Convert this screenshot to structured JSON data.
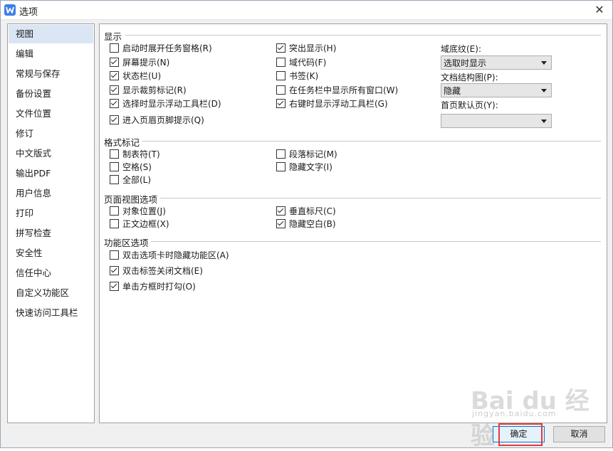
{
  "window": {
    "title": "选项"
  },
  "sidebar": {
    "items": [
      {
        "label": "视图",
        "active": true
      },
      {
        "label": "编辑"
      },
      {
        "label": "常规与保存"
      },
      {
        "label": "备份设置"
      },
      {
        "label": "文件位置"
      },
      {
        "label": "修订"
      },
      {
        "label": "中文版式"
      },
      {
        "label": "输出PDF"
      },
      {
        "label": "用户信息"
      },
      {
        "label": "打印"
      },
      {
        "label": "拼写检查"
      },
      {
        "label": "安全性"
      },
      {
        "label": "信任中心"
      },
      {
        "label": "自定义功能区"
      },
      {
        "label": "快速访问工具栏"
      }
    ]
  },
  "display": {
    "title": "显示",
    "options": [
      {
        "label": "启动时展开任务窗格(R)",
        "checked": false
      },
      {
        "label": "屏幕提示(N)",
        "checked": true
      },
      {
        "label": "状态栏(U)",
        "checked": true
      },
      {
        "label": "显示裁剪标记(R)",
        "checked": true
      },
      {
        "label": "选择时显示浮动工具栏(D)",
        "checked": true
      },
      {
        "label": "进入页眉页脚提示(Q)",
        "checked": true
      },
      {
        "label": "突出显示(H)",
        "checked": true
      },
      {
        "label": "域代码(F)",
        "checked": false
      },
      {
        "label": "书签(K)",
        "checked": false
      },
      {
        "label": "在任务栏中显示所有窗口(W)",
        "checked": false
      },
      {
        "label": "右键时显示浮动工具栏(G)",
        "checked": true
      }
    ],
    "field_shading": {
      "label": "域底纹(E):",
      "value": "选取时显示"
    },
    "doc_map": {
      "label": "文档结构图(P):",
      "value": "隐藏"
    },
    "first_page": {
      "label": "首页默认页(Y):",
      "value": ""
    }
  },
  "format_marks": {
    "title": "格式标记",
    "options": [
      {
        "label": "制表符(T)",
        "checked": false
      },
      {
        "label": "空格(S)",
        "checked": false
      },
      {
        "label": "全部(L)",
        "checked": false
      },
      {
        "label": "段落标记(M)",
        "checked": false
      },
      {
        "label": "隐藏文字(I)",
        "checked": false
      }
    ]
  },
  "page_view": {
    "title": "页面视图选项",
    "options": [
      {
        "label": "对象位置(J)",
        "checked": false
      },
      {
        "label": "正文边框(X)",
        "checked": false
      },
      {
        "label": "垂直标尺(C)",
        "checked": true
      },
      {
        "label": "隐藏空白(B)",
        "checked": true
      }
    ]
  },
  "ribbon": {
    "title": "功能区选项",
    "options": [
      {
        "label": "双击选项卡时隐藏功能区(A)",
        "checked": false
      },
      {
        "label": "双击标签关闭文档(E)",
        "checked": true
      },
      {
        "label": "单击方框时打勾(O)",
        "checked": true
      }
    ]
  },
  "buttons": {
    "ok": "确定",
    "cancel": "取消"
  },
  "watermark": {
    "text": "Bai du 经验",
    "sub": "jingyan.baidu.com"
  }
}
